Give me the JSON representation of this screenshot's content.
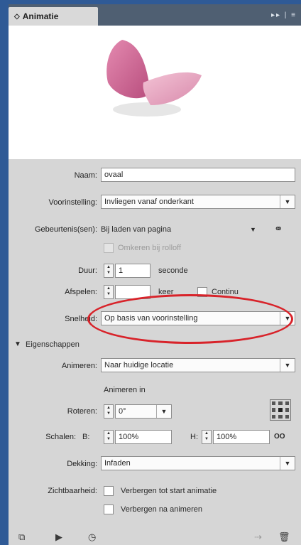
{
  "panel": {
    "tab_title": "Animatie",
    "tab_icon": "◇"
  },
  "form": {
    "naam": {
      "label": "Naam:",
      "value": "ovaal"
    },
    "voorinstelling": {
      "label": "Voorinstelling:",
      "value": "Invliegen vanaf onderkant"
    },
    "gebeurtenissen": {
      "label": "Gebeurtenis(sen):",
      "value": "Bij laden van pagina"
    },
    "omkeren": {
      "label": "Omkeren bij rolloff"
    },
    "duur": {
      "label": "Duur:",
      "value": "1",
      "unit": "seconde"
    },
    "afspelen": {
      "label": "Afspelen:",
      "value": "",
      "unit": "keer",
      "continu": "Continu"
    },
    "snelheid": {
      "label": "Snelheid:",
      "value": "Op basis van voorinstelling"
    }
  },
  "eigenschappen": {
    "title": "Eigenschappen",
    "animeren": {
      "label": "Animeren:",
      "value": "Naar huidige locatie"
    },
    "animeren_in": "Animeren in",
    "roteren": {
      "label": "Roteren:",
      "value": "0°"
    },
    "schalen": {
      "label": "Schalen:",
      "b_label": "B:",
      "b_value": "100%",
      "h_label": "H:",
      "h_value": "100%"
    },
    "dekking": {
      "label": "Dekking:",
      "value": "Infaden"
    },
    "zichtbaarheid": {
      "label": "Zichtbaarheid:",
      "option1": "Verbergen tot start animatie",
      "option2": "Verbergen na animeren"
    }
  },
  "colors": {
    "annotation_oval": "#d8232a",
    "butterfly_pink": "#d36a96",
    "butterfly_light": "#eaa9c2"
  }
}
